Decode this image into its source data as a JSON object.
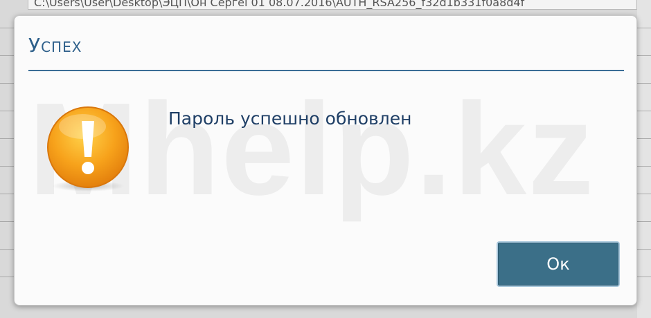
{
  "background": {
    "path_text": "C:\\Users\\User\\Desktop\\ЭЦП\\Он Сергеі 01 08.07.2016\\AUTH_RSA256_f32d1b331f0a8d4f"
  },
  "dialog": {
    "title": "Успех",
    "message": "Пароль успешно обновлен",
    "ok_label": "Ок",
    "icon": "warning-icon",
    "watermark": "Mhelp.kz"
  },
  "colors": {
    "title": "#2d5f8a",
    "message": "#1f3f66",
    "button": "#3b6f88",
    "icon_orange": "#f39c12"
  }
}
